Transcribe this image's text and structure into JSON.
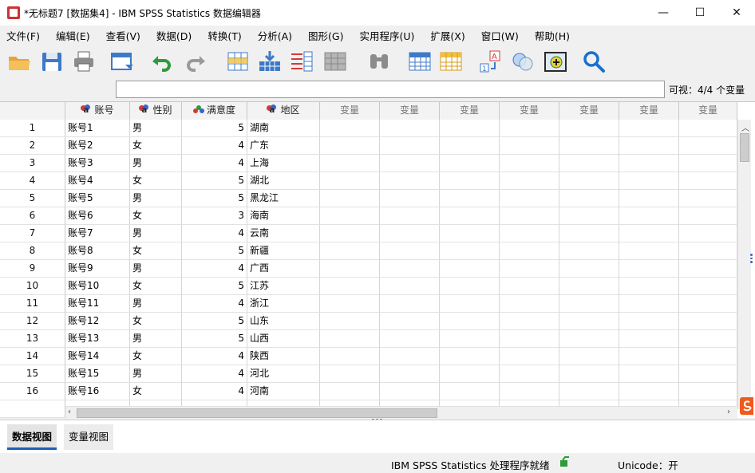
{
  "window": {
    "title": "*无标题7 [数据集4] - IBM SPSS Statistics 数据编辑器",
    "minimize": "—",
    "maximize": "☐",
    "close": "✕"
  },
  "menu": [
    {
      "label": "文件(F)"
    },
    {
      "label": "编辑(E)"
    },
    {
      "label": "查看(V)"
    },
    {
      "label": "数据(D)"
    },
    {
      "label": "转换(T)"
    },
    {
      "label": "分析(A)"
    },
    {
      "label": "图形(G)"
    },
    {
      "label": "实用程序(U)"
    },
    {
      "label": "扩展(X)"
    },
    {
      "label": "窗口(W)"
    },
    {
      "label": "帮助(H)"
    }
  ],
  "toolbar": {
    "icons": [
      "open-folder-icon",
      "save-icon",
      "print-icon",
      "dialog-recall-icon",
      "undo-icon",
      "redo-icon",
      "goto-case-icon",
      "goto-variable-icon",
      "variables-icon",
      "run-descriptives-icon",
      "find-icon",
      "insert-cases-icon",
      "insert-variable-icon",
      "split-file-icon",
      "weight-cases-icon",
      "select-cases-icon",
      "value-labels-icon",
      "use-variable-sets-icon",
      "search-icon"
    ]
  },
  "formula": {
    "value": "",
    "visible_label": "可视：4/4 个变量"
  },
  "grid": {
    "columns": [
      {
        "name": "账号",
        "type": "nominal"
      },
      {
        "name": "性别",
        "type": "nominal"
      },
      {
        "name": "满意度",
        "type": "ordinal"
      },
      {
        "name": "地区",
        "type": "nominal"
      },
      {
        "name": "变量",
        "type": "empty"
      },
      {
        "name": "变量",
        "type": "empty"
      },
      {
        "name": "变量",
        "type": "empty"
      },
      {
        "name": "变量",
        "type": "empty"
      },
      {
        "name": "变量",
        "type": "empty"
      },
      {
        "name": "变量",
        "type": "empty"
      },
      {
        "name": "变量",
        "type": "empty"
      }
    ],
    "rows": [
      {
        "n": "1",
        "acct": "账号1",
        "sex": "男",
        "sat": "5",
        "region": "湖南"
      },
      {
        "n": "2",
        "acct": "账号2",
        "sex": "女",
        "sat": "4",
        "region": "广东"
      },
      {
        "n": "3",
        "acct": "账号3",
        "sex": "男",
        "sat": "4",
        "region": "上海"
      },
      {
        "n": "4",
        "acct": "账号4",
        "sex": "女",
        "sat": "5",
        "region": "湖北"
      },
      {
        "n": "5",
        "acct": "账号5",
        "sex": "男",
        "sat": "5",
        "region": "黑龙江"
      },
      {
        "n": "6",
        "acct": "账号6",
        "sex": "女",
        "sat": "3",
        "region": "海南"
      },
      {
        "n": "7",
        "acct": "账号7",
        "sex": "男",
        "sat": "4",
        "region": "云南"
      },
      {
        "n": "8",
        "acct": "账号8",
        "sex": "女",
        "sat": "5",
        "region": "新疆"
      },
      {
        "n": "9",
        "acct": "账号9",
        "sex": "男",
        "sat": "4",
        "region": "广西"
      },
      {
        "n": "10",
        "acct": "账号10",
        "sex": "女",
        "sat": "5",
        "region": "江苏"
      },
      {
        "n": "11",
        "acct": "账号11",
        "sex": "男",
        "sat": "4",
        "region": "浙江"
      },
      {
        "n": "12",
        "acct": "账号12",
        "sex": "女",
        "sat": "5",
        "region": "山东"
      },
      {
        "n": "13",
        "acct": "账号13",
        "sex": "男",
        "sat": "5",
        "region": "山西"
      },
      {
        "n": "14",
        "acct": "账号14",
        "sex": "女",
        "sat": "4",
        "region": "陕西"
      },
      {
        "n": "15",
        "acct": "账号15",
        "sex": "男",
        "sat": "4",
        "region": "河北"
      },
      {
        "n": "16",
        "acct": "账号16",
        "sex": "女",
        "sat": "4",
        "region": "河南"
      }
    ]
  },
  "tabs": [
    {
      "label": "数据视图",
      "active": true
    },
    {
      "label": "变量视图",
      "active": false
    }
  ],
  "status": {
    "processor": "IBM SPSS Statistics 处理程序就绪",
    "unicode": "Unicode：开"
  },
  "colors": {
    "accent": "#1a5fb4",
    "nominal_red": "#d23a3a",
    "nominal_blue": "#3a62c8",
    "search_blue": "#1a6fd0"
  }
}
